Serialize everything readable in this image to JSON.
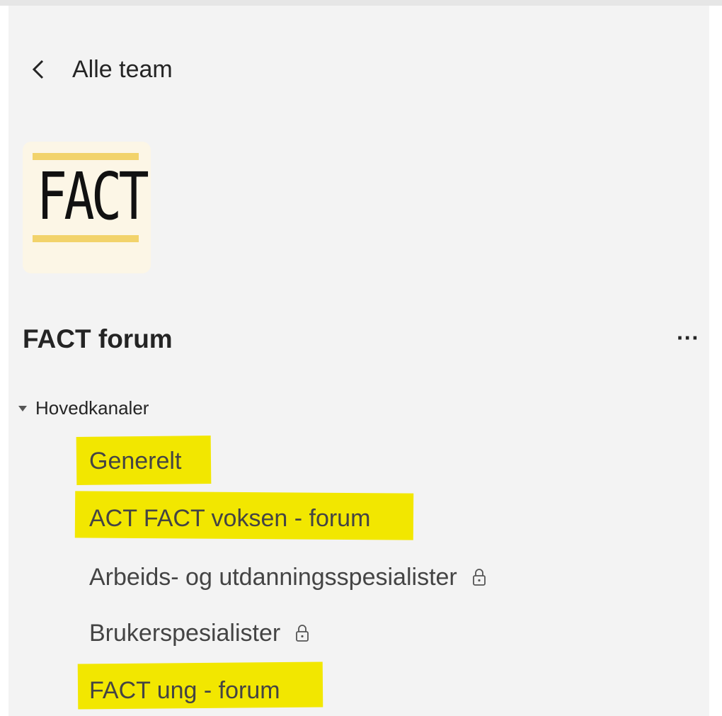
{
  "back": {
    "label": "Alle team",
    "icon": "chevron-left-icon"
  },
  "team": {
    "logo_text": "FACT",
    "logo_colors": {
      "background": "#fcf6e6",
      "bars": "#f2d36b",
      "text": "#111111"
    },
    "name": "FACT forum",
    "more_label": "···"
  },
  "section": {
    "label": "Hovedkanaler",
    "icon": "caret-down-icon"
  },
  "channels": [
    {
      "label": "Generelt",
      "highlighted": true,
      "private": false
    },
    {
      "label": "ACT FACT voksen - forum",
      "highlighted": true,
      "private": false
    },
    {
      "label": "Arbeids- og utdanningsspesialister",
      "highlighted": false,
      "private": true,
      "icon": "lock-icon"
    },
    {
      "label": "Brukerspesialister",
      "highlighted": false,
      "private": true,
      "icon": "lock-icon"
    },
    {
      "label": "FACT ung - forum",
      "highlighted": true,
      "private": false
    }
  ],
  "colors": {
    "panel": "#f3f3f3",
    "highlight": "#f2e700",
    "text": "#242424",
    "channel_text": "#444444"
  }
}
